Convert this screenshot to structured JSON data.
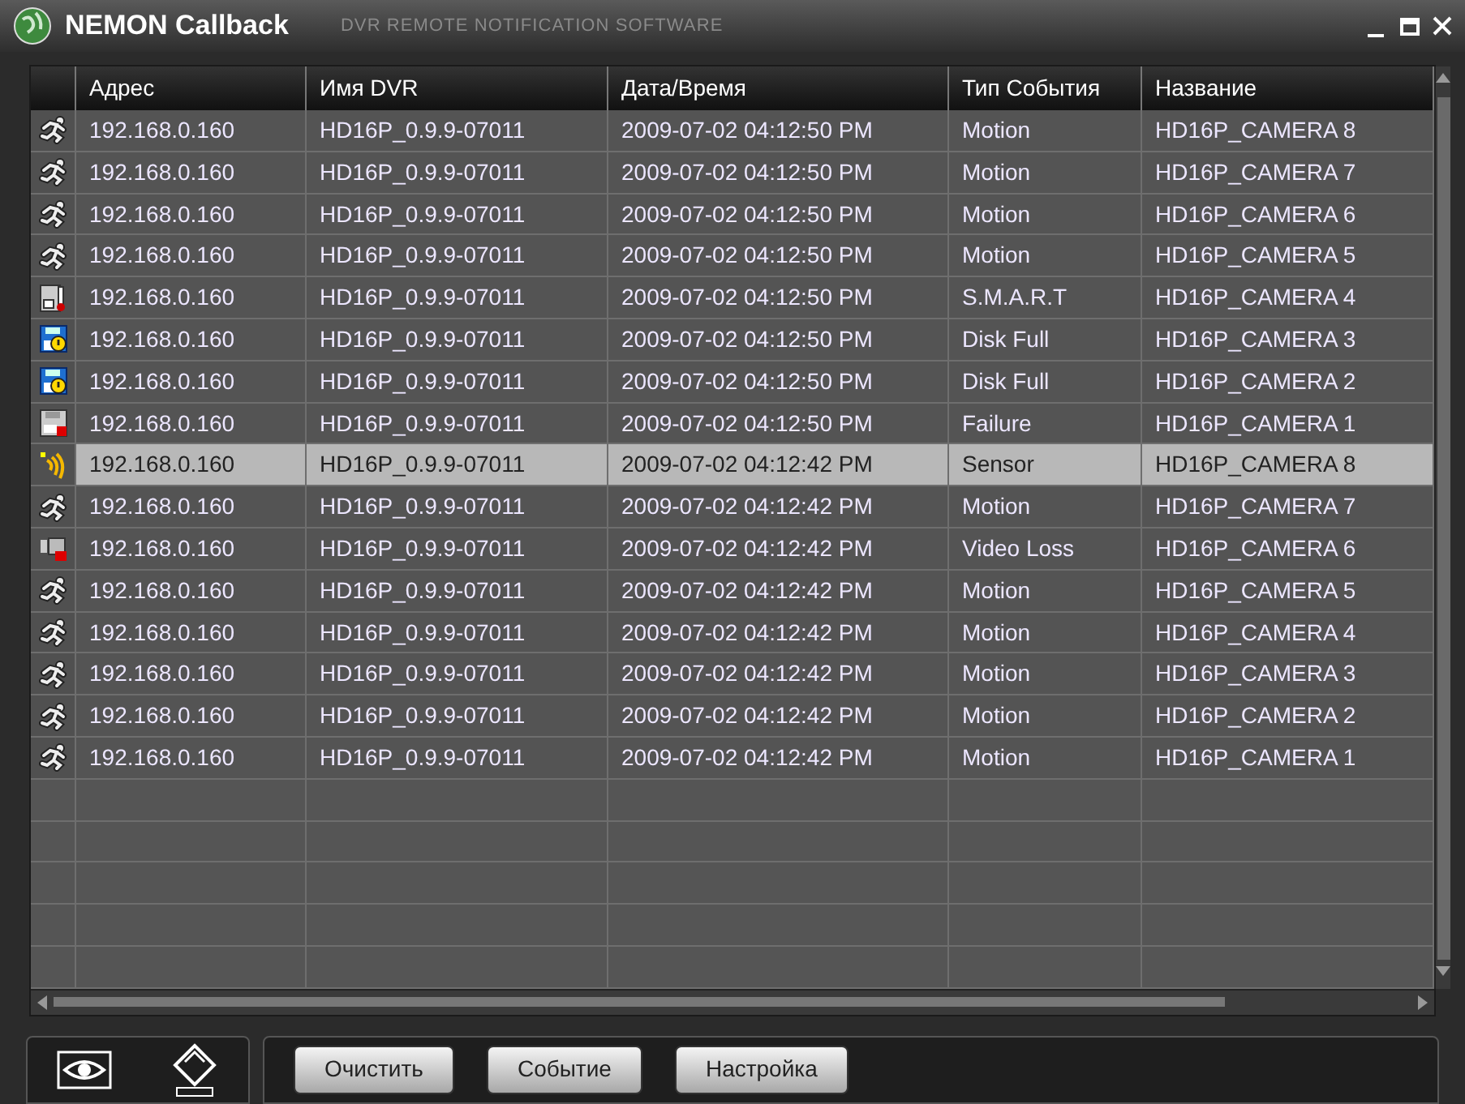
{
  "window": {
    "title": "NEMON Callback",
    "subtitle": "DVR REMOTE NOTIFICATION SOFTWARE"
  },
  "table": {
    "columns": [
      "Адрес",
      "Имя DVR",
      "Дата/Время",
      "Тип События",
      "Название"
    ],
    "rows": [
      {
        "kind": "motion",
        "selected": false,
        "cells": [
          "192.168.0.160",
          "HD16P_0.9.9-07011",
          "2009-07-02 04:12:50 PM",
          "Motion",
          "HD16P_CAMERA 8"
        ]
      },
      {
        "kind": "motion",
        "selected": false,
        "cells": [
          "192.168.0.160",
          "HD16P_0.9.9-07011",
          "2009-07-02 04:12:50 PM",
          "Motion",
          "HD16P_CAMERA 7"
        ]
      },
      {
        "kind": "motion",
        "selected": false,
        "cells": [
          "192.168.0.160",
          "HD16P_0.9.9-07011",
          "2009-07-02 04:12:50 PM",
          "Motion",
          "HD16P_CAMERA 6"
        ]
      },
      {
        "kind": "motion",
        "selected": false,
        "cells": [
          "192.168.0.160",
          "HD16P_0.9.9-07011",
          "2009-07-02 04:12:50 PM",
          "Motion",
          "HD16P_CAMERA 5"
        ]
      },
      {
        "kind": "smart",
        "selected": false,
        "cells": [
          "192.168.0.160",
          "HD16P_0.9.9-07011",
          "2009-07-02 04:12:50 PM",
          "S.M.A.R.T",
          "HD16P_CAMERA 4"
        ]
      },
      {
        "kind": "disk_full",
        "selected": false,
        "cells": [
          "192.168.0.160",
          "HD16P_0.9.9-07011",
          "2009-07-02 04:12:50 PM",
          "Disk Full",
          "HD16P_CAMERA 3"
        ]
      },
      {
        "kind": "disk_full",
        "selected": false,
        "cells": [
          "192.168.0.160",
          "HD16P_0.9.9-07011",
          "2009-07-02 04:12:50 PM",
          "Disk Full",
          "HD16P_CAMERA 2"
        ]
      },
      {
        "kind": "failure",
        "selected": false,
        "cells": [
          "192.168.0.160",
          "HD16P_0.9.9-07011",
          "2009-07-02 04:12:50 PM",
          "Failure",
          "HD16P_CAMERA 1"
        ]
      },
      {
        "kind": "sensor",
        "selected": true,
        "cells": [
          "192.168.0.160",
          "HD16P_0.9.9-07011",
          "2009-07-02 04:12:42 PM",
          "Sensor",
          "HD16P_CAMERA 8"
        ]
      },
      {
        "kind": "motion",
        "selected": false,
        "cells": [
          "192.168.0.160",
          "HD16P_0.9.9-07011",
          "2009-07-02 04:12:42 PM",
          "Motion",
          "HD16P_CAMERA 7"
        ]
      },
      {
        "kind": "video_loss",
        "selected": false,
        "cells": [
          "192.168.0.160",
          "HD16P_0.9.9-07011",
          "2009-07-02 04:12:42 PM",
          "Video Loss",
          "HD16P_CAMERA 6"
        ]
      },
      {
        "kind": "motion",
        "selected": false,
        "cells": [
          "192.168.0.160",
          "HD16P_0.9.9-07011",
          "2009-07-02 04:12:42 PM",
          "Motion",
          "HD16P_CAMERA 5"
        ]
      },
      {
        "kind": "motion",
        "selected": false,
        "cells": [
          "192.168.0.160",
          "HD16P_0.9.9-07011",
          "2009-07-02 04:12:42 PM",
          "Motion",
          "HD16P_CAMERA 4"
        ]
      },
      {
        "kind": "motion",
        "selected": false,
        "cells": [
          "192.168.0.160",
          "HD16P_0.9.9-07011",
          "2009-07-02 04:12:42 PM",
          "Motion",
          "HD16P_CAMERA 3"
        ]
      },
      {
        "kind": "motion",
        "selected": false,
        "cells": [
          "192.168.0.160",
          "HD16P_0.9.9-07011",
          "2009-07-02 04:12:42 PM",
          "Motion",
          "HD16P_CAMERA 2"
        ]
      },
      {
        "kind": "motion",
        "selected": false,
        "cells": [
          "192.168.0.160",
          "HD16P_0.9.9-07011",
          "2009-07-02 04:12:42 PM",
          "Motion",
          "HD16P_CAMERA 1"
        ]
      }
    ]
  },
  "buttons": [
    "Очистить",
    "Событие",
    "Настройка"
  ]
}
